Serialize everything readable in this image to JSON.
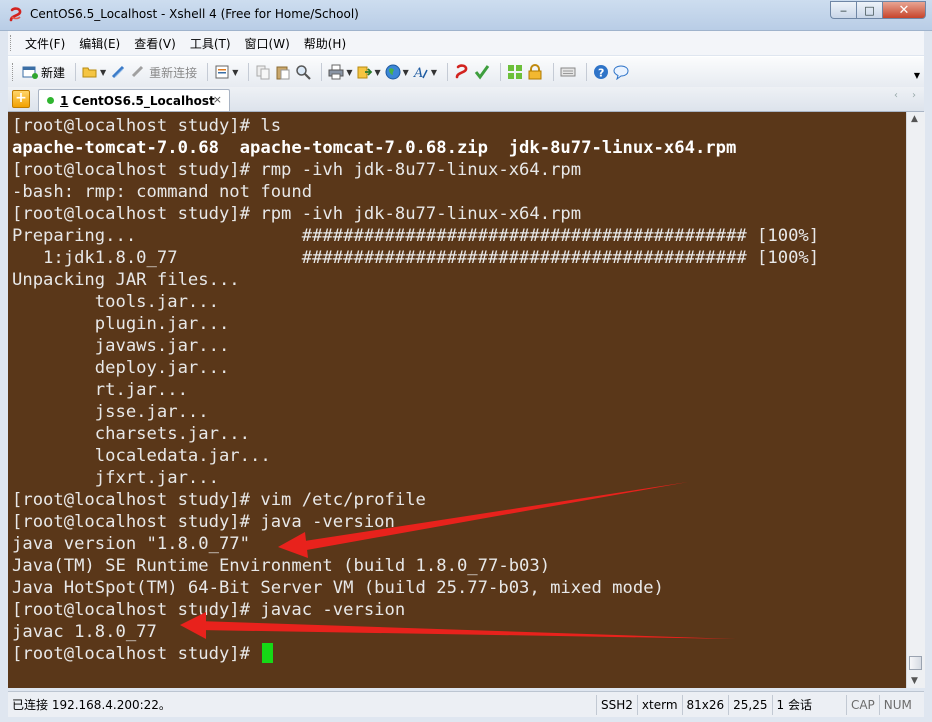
{
  "window": {
    "title": "CentOS6.5_Localhost - Xshell 4 (Free for Home/School)",
    "controls": {
      "minimize": "‒",
      "maximize": "□",
      "close": "✕"
    }
  },
  "menu": {
    "items": [
      "文件(F)",
      "编辑(E)",
      "查看(V)",
      "工具(T)",
      "窗口(W)",
      "帮助(H)"
    ]
  },
  "toolbar": {
    "new_label": "新建",
    "reconnect_label": "重新连接"
  },
  "tabs": {
    "add_label": "+",
    "items": [
      {
        "index": "1",
        "label": "CentOS6.5_Localhost",
        "close": "×",
        "status_color": "#2fb52f"
      }
    ],
    "nav_prev": "‹",
    "nav_next": "›"
  },
  "terminal": {
    "background": "#5a3719",
    "text_color": "#e8e8e8",
    "cursor_color": "#16d916",
    "annotation_color": "#e8221c",
    "lines": [
      "[root@localhost study]# ls",
      "apache-tomcat-7.0.68  apache-tomcat-7.0.68.zip  jdk-8u77-linux-x64.rpm",
      "[root@localhost study]# rmp -ivh jdk-8u77-linux-x64.rpm",
      "-bash: rmp: command not found",
      "[root@localhost study]# rpm -ivh jdk-8u77-linux-x64.rpm",
      "Preparing...                ########################################### [100%]",
      "   1:jdk1.8.0_77            ########################################### [100%]",
      "Unpacking JAR files...",
      "        tools.jar...",
      "        plugin.jar...",
      "        javaws.jar...",
      "        deploy.jar...",
      "        rt.jar...",
      "        jsse.jar...",
      "        charsets.jar...",
      "        localedata.jar...",
      "        jfxrt.jar...",
      "[root@localhost study]# vim /etc/profile",
      "[root@localhost study]# java -version",
      "java version \"1.8.0_77\"",
      "Java(TM) SE Runtime Environment (build 1.8.0_77-b03)",
      "Java HotSpot(TM) 64-Bit Server VM (build 25.77-b03, mixed mode)",
      "[root@localhost study]# javac -version",
      "javac 1.8.0_77",
      "[root@localhost study]# "
    ]
  },
  "scrollbar": {
    "up": "▲",
    "down": "▼"
  },
  "status": {
    "connection": "已连接 192.168.4.200:22。",
    "protocol": "SSH2",
    "terminal_type": "xterm",
    "size": "81x26",
    "cursor_pos": "25,25",
    "sessions": "1 会话",
    "caps": "CAP",
    "num": "NUM"
  }
}
